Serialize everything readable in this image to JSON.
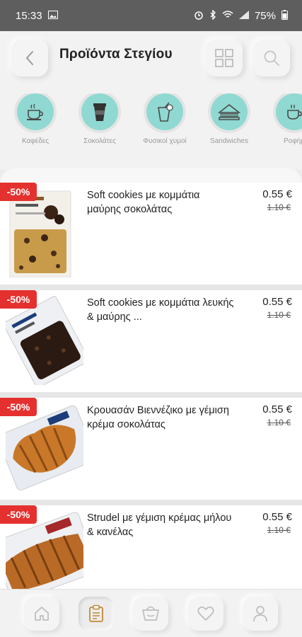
{
  "status_bar": {
    "time": "15:33",
    "battery": "75%"
  },
  "header": {
    "title": "Προϊόντα Στεγίου"
  },
  "categories": [
    {
      "label": "Καφέδες",
      "icon": "coffee-cup-icon"
    },
    {
      "label": "Σοκολάτες",
      "icon": "takeaway-cup-icon"
    },
    {
      "label": "Φυσικοί χυμοί",
      "icon": "juice-glass-icon"
    },
    {
      "label": "Sandwiches",
      "icon": "sandwich-icon"
    },
    {
      "label": "Ροφήμ",
      "icon": "hot-drink-icon"
    }
  ],
  "products": [
    {
      "name": "Soft cookies με κομμάτια μαύρης σοκολάτας",
      "price": "0.55 €",
      "old_price": "1.10 €",
      "discount": "-50%"
    },
    {
      "name": "Soft cookies με κομμάτια λευκής & μαύρης ...",
      "price": "0.55 €",
      "old_price": "1.10 €",
      "discount": "-50%"
    },
    {
      "name": "Κρουασάν Βιεννέζικο με γέμιση κρέμα σοκολάτας",
      "price": "0.55 €",
      "old_price": "1.10 €",
      "discount": "-50%"
    },
    {
      "name": "Strudel με γέμιση κρέμας μήλου & κανέλας",
      "price": "0.55 €",
      "old_price": "1.10 €",
      "discount": "-50%"
    }
  ],
  "colors": {
    "accent": "#8fd9d2",
    "discount": "#e4312f"
  },
  "bottom_nav": {
    "active": "clipboard-icon",
    "items": [
      "home-icon",
      "clipboard-icon",
      "basket-icon",
      "heart-icon",
      "user-icon"
    ]
  }
}
